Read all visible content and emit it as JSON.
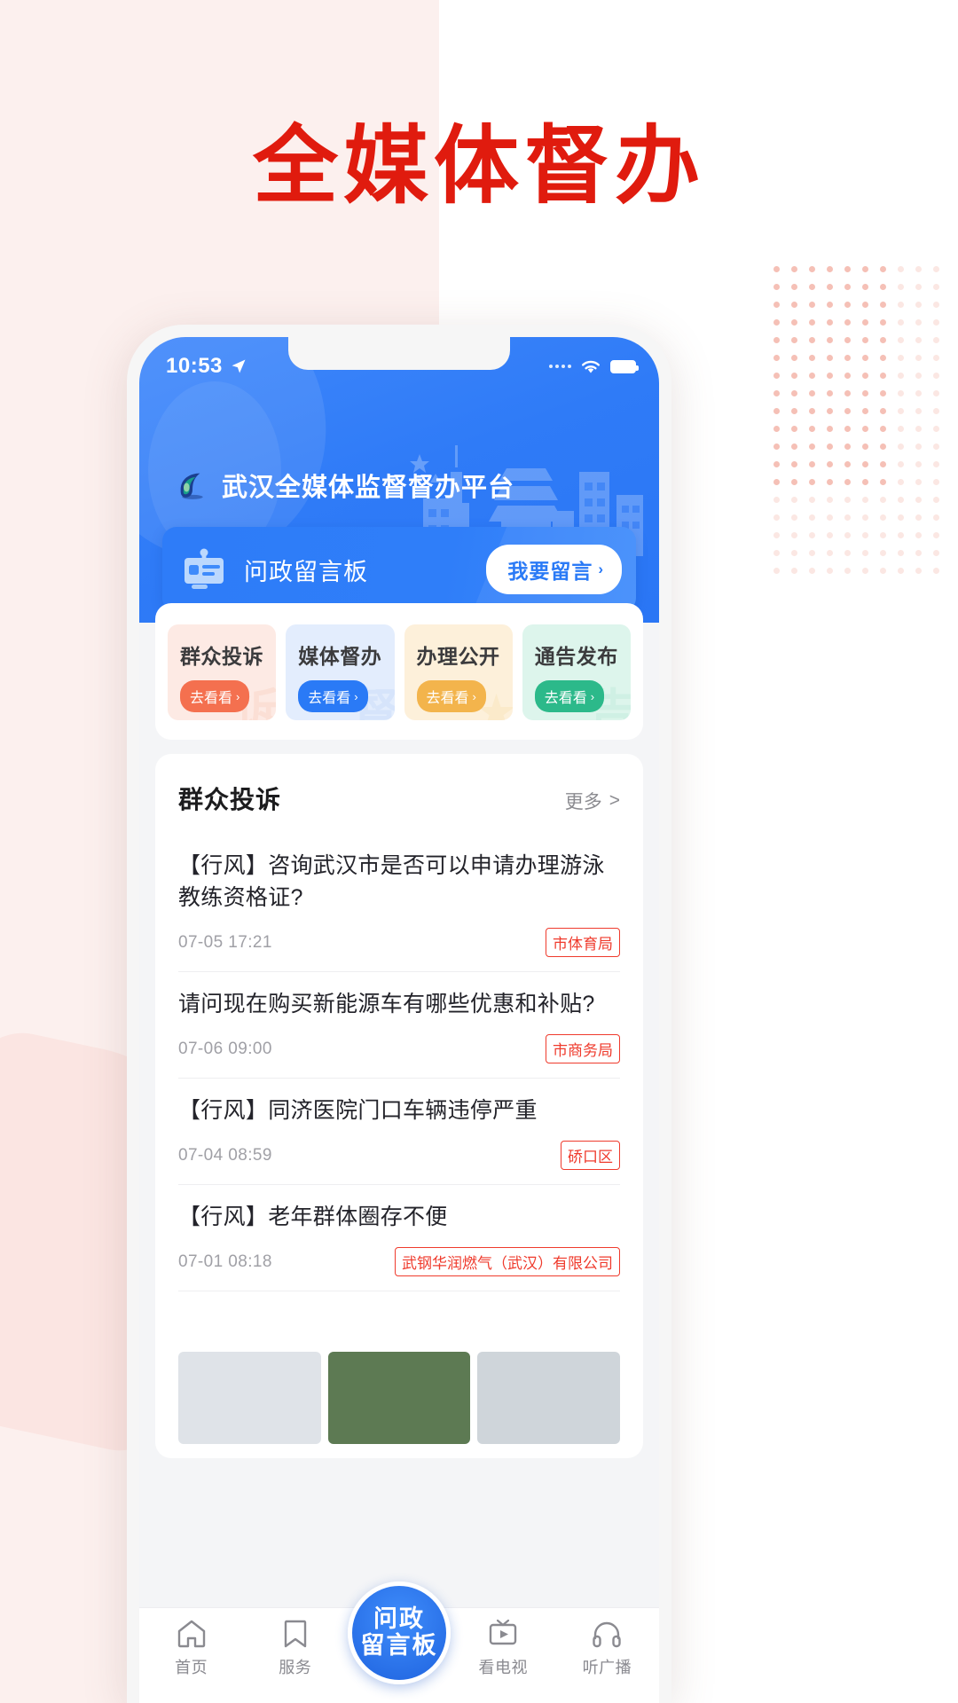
{
  "poster": {
    "title": "全媒体督办",
    "title_color": "#e01b0e"
  },
  "phone": {
    "statusbar": {
      "time": "10:53",
      "location_icon": "location-arrow-icon",
      "signal_icon": "signal-dots-icon",
      "wifi_icon": "wifi-icon",
      "battery_icon": "battery-icon"
    },
    "header": {
      "logo_icon": "wuhan-wave-logo-icon",
      "brand": "武汉全媒体监督督办平台",
      "skyline_icon": "wuhan-skyline-icon",
      "accent": "#2a76f5"
    },
    "banner": {
      "icon": "message-board-icon",
      "title": "问政留言板",
      "button_label": "我要留言",
      "button_chevron": "›"
    },
    "quick_cards": [
      {
        "title": "群众投诉",
        "button": "去看看",
        "chevron": "›",
        "bg": "#fdeae4",
        "btn_bg": "#f4704f",
        "ghost": "诉",
        "ghost_color": "#f8c7b4"
      },
      {
        "title": "媒体督办",
        "button": "去看看",
        "chevron": "›",
        "bg": "#e3edfd",
        "btn_bg": "#2a7af6",
        "ghost": "督",
        "ghost_color": "#b9d2f7"
      },
      {
        "title": "办理公开",
        "button": "去看看",
        "chevron": "›",
        "bg": "#fdf0da",
        "btn_bg": "#f3b44c",
        "ghost": "★",
        "ghost_color": "#f7dca6"
      },
      {
        "title": "通告发布",
        "button": "去看看",
        "chevron": "›",
        "bg": "#ddf5ec",
        "btn_bg": "#2cb98a",
        "ghost": "告",
        "ghost_color": "#aee5d2"
      }
    ],
    "list": {
      "heading": "群众投诉",
      "more_label": "更多",
      "more_chevron": ">",
      "items": [
        {
          "title": "【行风】咨询武汉市是否可以申请办理游泳教练资格证?",
          "date": "07-05 17:21",
          "badge": "市体育局"
        },
        {
          "title": "请问现在购买新能源车有哪些优惠和补贴?",
          "date": "07-06 09:00",
          "badge": "市商务局"
        },
        {
          "title": "【行风】同济医院门口车辆违停严重",
          "date": "07-04 08:59",
          "badge": "硚口区"
        },
        {
          "title": "【行风】老年群体圈存不便",
          "date": "07-01 08:18",
          "badge": "武钢华润燃气（武汉）有限公司"
        }
      ]
    },
    "tabbar": {
      "items": [
        {
          "label": "首页",
          "icon": "home-icon",
          "active": false
        },
        {
          "label": "服务",
          "icon": "bookmark-icon",
          "active": false
        },
        {
          "label": "看电视",
          "icon": "tv-play-icon",
          "active": false
        },
        {
          "label": "听广播",
          "icon": "headphones-icon",
          "active": false
        }
      ],
      "center": {
        "line1": "问政",
        "line2": "留言板",
        "icon": "message-board-badge-icon"
      }
    }
  }
}
